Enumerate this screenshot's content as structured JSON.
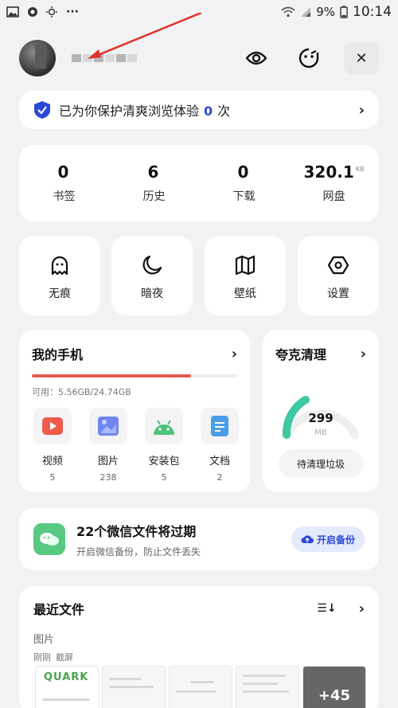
{
  "status_bar": {
    "battery": "9%",
    "time": "10:14",
    "more": "···"
  },
  "profile": {
    "eye_icon": "eye-icon",
    "face_icon": "face-icon",
    "close_glyph": "✕"
  },
  "protection": {
    "prefix": "已为你保护清爽浏览体验",
    "count": "0",
    "suffix": "次",
    "chevron": "›"
  },
  "stats": [
    {
      "value": "0",
      "unit": "",
      "label": "书签"
    },
    {
      "value": "6",
      "unit": "",
      "label": "历史"
    },
    {
      "value": "0",
      "unit": "",
      "label": "下载"
    },
    {
      "value": "320.1",
      "unit": "KB",
      "label": "网盘"
    }
  ],
  "tools": [
    {
      "label": "无痕",
      "icon": "ghost-icon"
    },
    {
      "label": "暗夜",
      "icon": "moon-icon"
    },
    {
      "label": "壁纸",
      "icon": "map-icon"
    },
    {
      "label": "设置",
      "icon": "settings-icon"
    }
  ],
  "my_phone": {
    "title": "我的手机",
    "chevron": "›",
    "storage_text": "可用：5.56GB/24.74GB",
    "used_fraction": 0.775,
    "apps": [
      {
        "name": "视频",
        "count": "5",
        "color": "#ef5a4a"
      },
      {
        "name": "图片",
        "count": "238",
        "color": "#6f86f0"
      },
      {
        "name": "安装包",
        "count": "5",
        "color": "#4cc27a"
      },
      {
        "name": "文档",
        "count": "2",
        "color": "#4a9de8"
      }
    ]
  },
  "cleaner": {
    "title": "夸克清理",
    "chevron": "›",
    "value": "299",
    "unit": "MB",
    "button": "待清理垃圾",
    "gauge_color": "#3fc9a3"
  },
  "wechat": {
    "title": "22个微信文件将过期",
    "subtitle": "开启微信备份，防止文件丢失",
    "button": "开启备份"
  },
  "recent": {
    "title": "最近文件",
    "sort_glyph": "☰↓",
    "chevron": "›",
    "category": "图片",
    "time": "刚刚",
    "source": "截屏",
    "more": "+45",
    "thumb_logo": "QUARK"
  },
  "colors": {
    "accent": "#2a49d8",
    "background": "#f2f2f4",
    "card": "#ffffff"
  }
}
